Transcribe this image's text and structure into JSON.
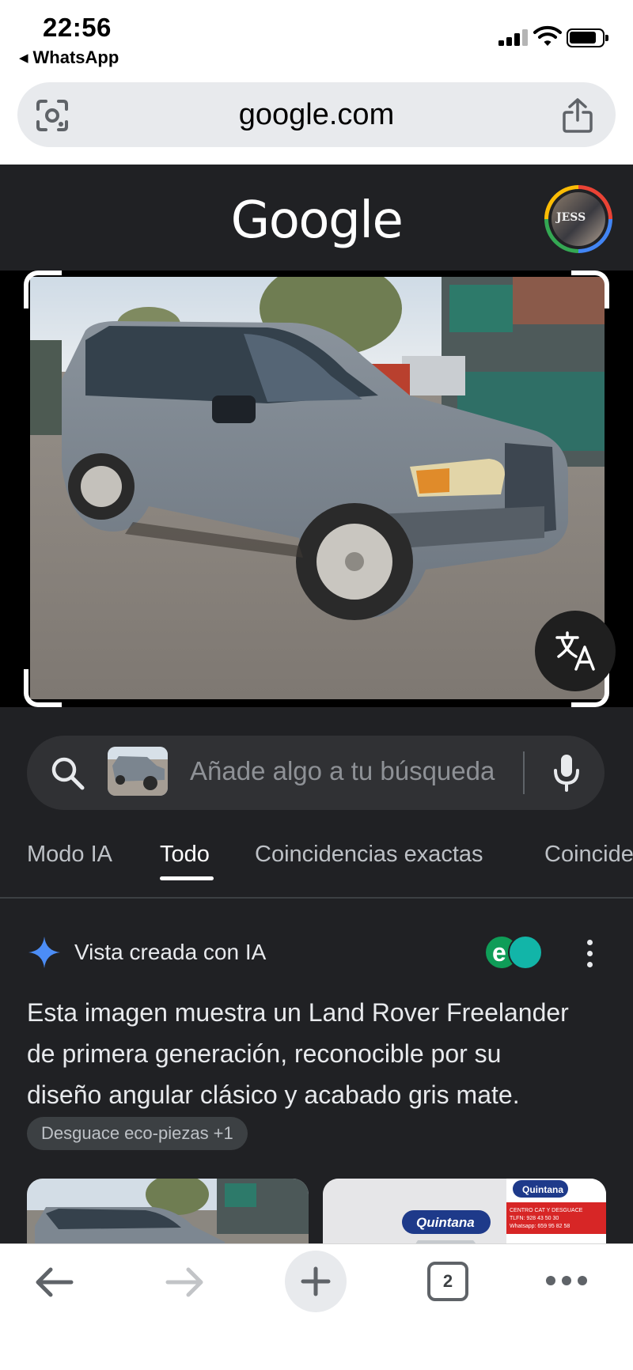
{
  "status_bar": {
    "time": "22:56",
    "back_app": "WhatsApp",
    "signal_icon": "cellular-signal-icon",
    "wifi_icon": "wifi-icon",
    "battery_icon": "battery-icon"
  },
  "browser": {
    "url": "google.com",
    "lens_icon": "lens-camera-icon",
    "share_icon": "share-icon"
  },
  "header": {
    "logo": "Google",
    "avatar_text": "JESS"
  },
  "image_viewer": {
    "translate_icon": "translate-icon"
  },
  "search": {
    "placeholder": "Añade algo a tu búsqueda",
    "search_icon": "search-icon",
    "mic_icon": "microphone-icon"
  },
  "tabs": [
    {
      "label": "Modo IA",
      "active": false
    },
    {
      "label": "Todo",
      "active": true
    },
    {
      "label": "Coincidencias exactas",
      "active": false
    },
    {
      "label": "Coincide",
      "active": false
    }
  ],
  "ai_overview": {
    "title": "Vista creada con IA",
    "body_lines": [
      "Esta imagen muestra un Land Rover Freelander",
      "de primera generación, reconocible por su",
      "diseño angular clásico y acabado gris mate."
    ],
    "source_chip": "Desguace eco-piezas +1",
    "source_logo_letter": "e"
  },
  "result_cards": [
    {
      "type": "car-photo"
    },
    {
      "type": "dealer-logo",
      "brand": "Quintana",
      "caption_lines": [
        "CENTRO CAT Y DESGUACE",
        "TLFN: 928 43 50 30",
        "Whatsapp: 659 95 82 58"
      ]
    }
  ],
  "toolbar": {
    "back_icon": "arrow-left-icon",
    "forward_icon": "arrow-right-icon",
    "new_tab_icon": "plus-icon",
    "tab_count": "2",
    "more_icon": "more-horizontal-icon"
  },
  "colors": {
    "page_bg": "#202124",
    "search_bg": "#303134",
    "text_primary": "#e8eaed",
    "text_secondary": "#bdc1c6",
    "ai_spark": "#4c8df6"
  }
}
